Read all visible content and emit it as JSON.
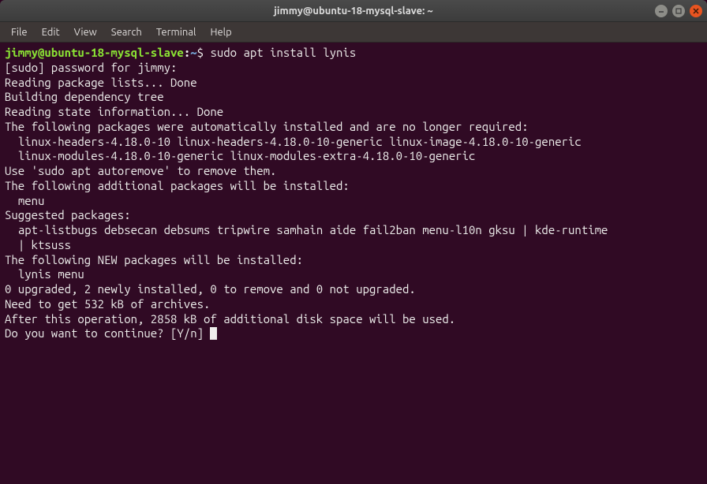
{
  "window": {
    "title": "jimmy@ubuntu-18-mysql-slave: ~"
  },
  "menu": {
    "items": [
      "File",
      "Edit",
      "View",
      "Search",
      "Terminal",
      "Help"
    ]
  },
  "prompt": {
    "user_host": "jimmy@ubuntu-18-mysql-slave",
    "colon": ":",
    "path": "~",
    "symbol": "$"
  },
  "command": "sudo apt install lynis",
  "output": {
    "l1": "[sudo] password for jimmy:",
    "l2": "Reading package lists... Done",
    "l3": "Building dependency tree",
    "l4": "Reading state information... Done",
    "l5": "The following packages were automatically installed and are no longer required:",
    "l6": "  linux-headers-4.18.0-10 linux-headers-4.18.0-10-generic linux-image-4.18.0-10-generic",
    "l7": "  linux-modules-4.18.0-10-generic linux-modules-extra-4.18.0-10-generic",
    "l8": "Use 'sudo apt autoremove' to remove them.",
    "l9": "The following additional packages will be installed:",
    "l10": "  menu",
    "l11": "Suggested packages:",
    "l12": "  apt-listbugs debsecan debsums tripwire samhain aide fail2ban menu-l10n gksu | kde-runtime",
    "l13": "  | ktsuss",
    "l14": "The following NEW packages will be installed:",
    "l15": "  lynis menu",
    "l16": "0 upgraded, 2 newly installed, 0 to remove and 0 not upgraded.",
    "l17": "Need to get 532 kB of archives.",
    "l18": "After this operation, 2858 kB of additional disk space will be used.",
    "l19": "Do you want to continue? [Y/n] "
  }
}
